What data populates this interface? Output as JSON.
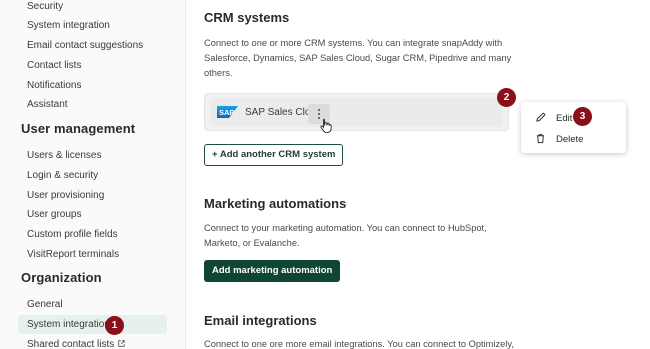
{
  "sidebar": {
    "items_top": [
      "Security",
      "System integration",
      "Email contact suggestions",
      "Contact lists",
      "Notifications",
      "Assistant"
    ],
    "user_management": {
      "heading": "User management",
      "items": [
        "Users & licenses",
        "Login & security",
        "User provisioning",
        "User groups",
        "Custom profile fields",
        "VisitReport terminals"
      ]
    },
    "organization": {
      "heading": "Organization",
      "items": [
        "General",
        "System integration",
        "Shared contact lists"
      ]
    },
    "active_item": "System integration"
  },
  "crm": {
    "title": "CRM systems",
    "description": "Connect to one or more CRM systems. You can integrate snapAddy with Salesforce, Dynamics, SAP Sales Cloud, Sugar CRM, Pipedrive and many others.",
    "connected_system": "SAP Sales Cloud",
    "logo_text": "SAP",
    "add_button": "+ Add another CRM system"
  },
  "marketing": {
    "title": "Marketing automations",
    "description": "Connect to your marketing automation. You can connect to HubSpot, Marketo, or Evalanche.",
    "add_button": "Add marketing automation"
  },
  "email": {
    "title": "Email integrations",
    "description": "Connect to one ore more email integrations. You can connect to Optimizely,"
  },
  "menu": {
    "edit_label": "Edit",
    "delete_label": "Delete"
  },
  "badges": [
    "1",
    "2",
    "3"
  ],
  "colors": {
    "accent": "#0e4633",
    "badge": "#8b0f1a",
    "active_bg": "#e7f1ec",
    "sap_blue": "#0a7fd4"
  }
}
